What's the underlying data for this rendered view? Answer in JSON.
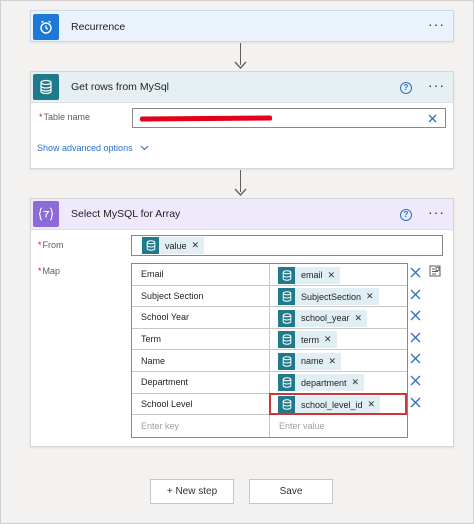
{
  "colors": {
    "recurrence_accent": "#1e78d7",
    "mysql_accent": "#1f7a8c",
    "select_accent": "#8c6bd6",
    "token_bg": "#e1eff4",
    "link": "#2b6fcf",
    "highlight": "#d13438"
  },
  "recurrence": {
    "icon": "alarm-clock-icon",
    "title": "Recurrence",
    "more": "···"
  },
  "mysql": {
    "icon": "database-icon",
    "title": "Get rows from MySql",
    "help": "?",
    "more": "···",
    "table_name_required": "*",
    "table_name_label": "Table name",
    "show_advanced": "Show advanced options",
    "redacted": true
  },
  "select": {
    "icon": "data-operation-icon",
    "title": "Select MySQL for Array",
    "help": "?",
    "more": "···",
    "from_required": "*",
    "from_label": "From",
    "from_token": "value",
    "map_required": "*",
    "map_label": "Map",
    "rows": [
      {
        "key": "Email",
        "value": "email",
        "highlighted": false
      },
      {
        "key": "Subject Section",
        "value": "SubjectSection",
        "highlighted": false
      },
      {
        "key": "School Year",
        "value": "school_year",
        "highlighted": false
      },
      {
        "key": "Term",
        "value": "term",
        "highlighted": false
      },
      {
        "key": "Name",
        "value": "name",
        "highlighted": false
      },
      {
        "key": "Department",
        "value": "department",
        "highlighted": false
      },
      {
        "key": "School Level",
        "value": "school_level_id",
        "highlighted": true
      }
    ],
    "enter_key_placeholder": "Enter key",
    "enter_value_placeholder": "Enter value"
  },
  "footer": {
    "new_step": "+ New step",
    "save": "Save"
  }
}
